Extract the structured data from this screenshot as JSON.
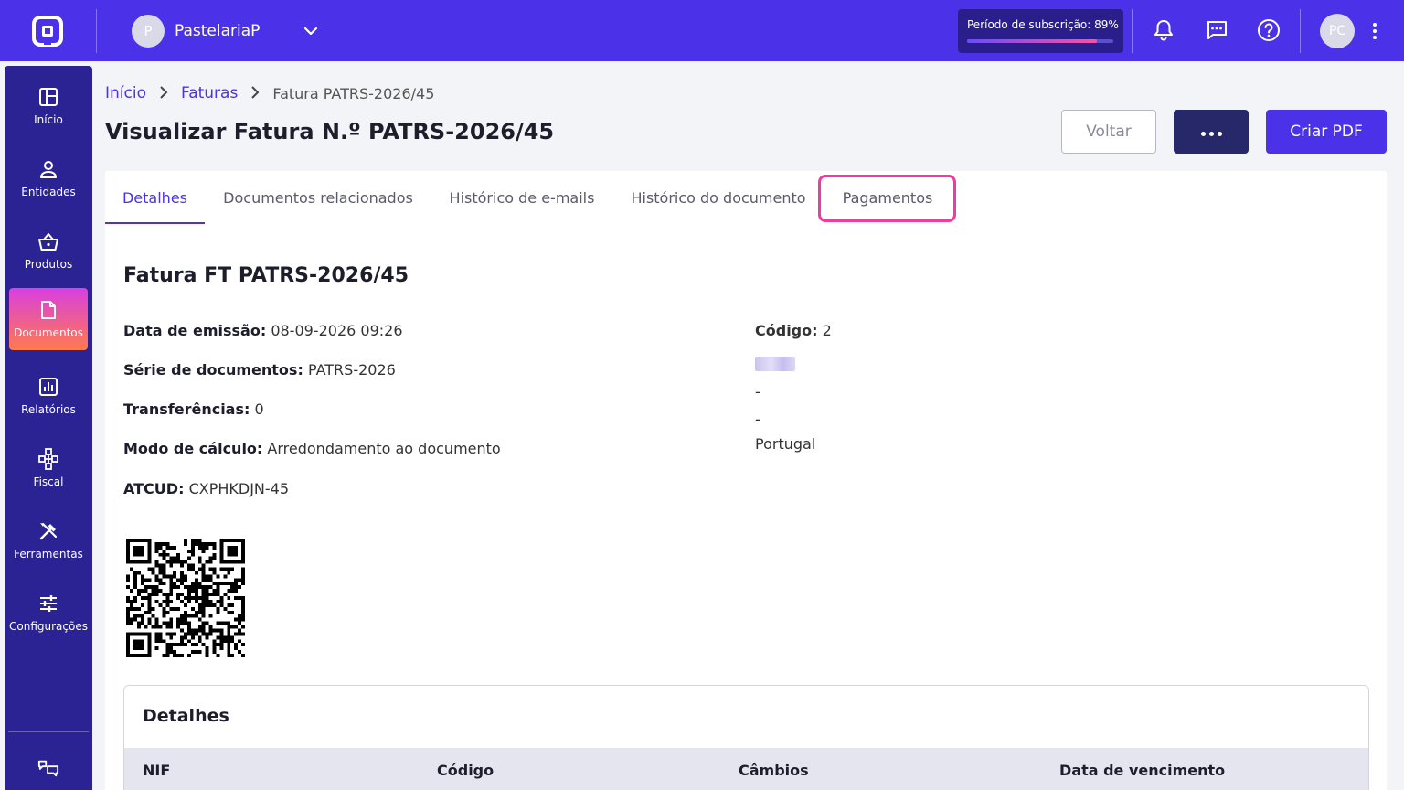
{
  "topbar": {
    "company_initial": "P",
    "company_name": "PastelariaP",
    "subscription_label": "Período de subscrição: 89%",
    "subscription_progress": 0.89,
    "user_initials": "PC"
  },
  "sidebar": {
    "items": [
      {
        "label": "Início",
        "icon": "dashboard-icon"
      },
      {
        "label": "Entidades",
        "icon": "person-icon"
      },
      {
        "label": "Produtos",
        "icon": "basket-icon"
      },
      {
        "label": "Documentos",
        "icon": "document-icon",
        "active": true
      },
      {
        "label": "Relatórios",
        "icon": "chart-icon"
      },
      {
        "label": "Fiscal",
        "icon": "network-icon"
      },
      {
        "label": "Ferramentas",
        "icon": "tools-icon"
      },
      {
        "label": "Configurações",
        "icon": "sliders-icon"
      }
    ]
  },
  "breadcrumb": {
    "home": "Início",
    "section": "Faturas",
    "current": "Fatura PATRS-2026/45"
  },
  "page": {
    "title": "Visualizar Fatura N.º PATRS-2026/45",
    "back_label": "Voltar",
    "pdf_label": "Criar PDF"
  },
  "tabs": [
    {
      "label": "Detalhes",
      "active": true
    },
    {
      "label": "Documentos relacionados"
    },
    {
      "label": "Histórico de e-mails"
    },
    {
      "label": "Histórico do documento"
    },
    {
      "label": "Pagamentos",
      "highlighted": true
    }
  ],
  "document": {
    "title": "Fatura FT PATRS-2026/45",
    "fields": [
      {
        "label": "Data de emissão:",
        "value": "08-09-2026 09:26"
      },
      {
        "label": "Série de documentos:",
        "value": "PATRS-2026"
      },
      {
        "label": "Transferências:",
        "value": "0"
      },
      {
        "label": "Modo de cálculo:",
        "value": "Arredondamento ao documento"
      },
      {
        "label": "ATCUD:",
        "value": "CXPHKDJN-45"
      }
    ],
    "client": {
      "code_label": "Código:",
      "code_value": "2",
      "line1": "-",
      "line2": "-",
      "country": "Portugal"
    }
  },
  "details": {
    "title": "Detalhes",
    "columns": [
      "NIF",
      "Código",
      "Câmbios",
      "Data de vencimento"
    ]
  },
  "colors": {
    "primary": "#4b32e8",
    "sidebar": "#2b2294",
    "highlight": "#f03ca0",
    "dark_button": "#262869"
  }
}
